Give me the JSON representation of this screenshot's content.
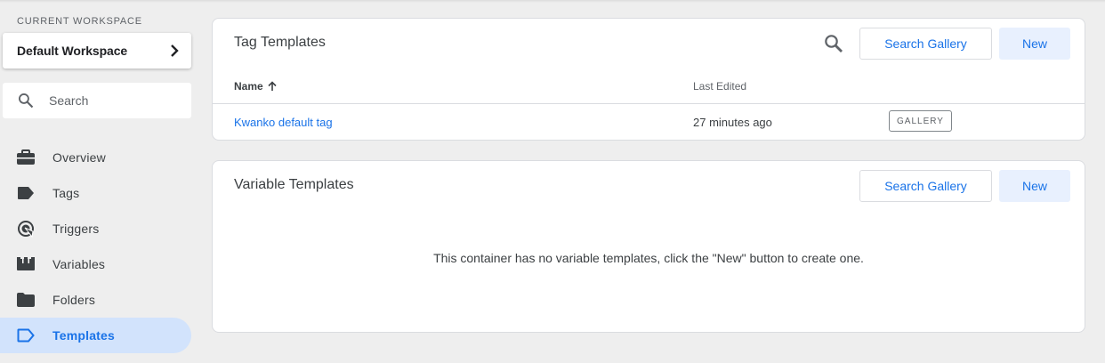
{
  "workspace": {
    "label": "CURRENT WORKSPACE",
    "name": "Default Workspace"
  },
  "search": {
    "placeholder": "Search"
  },
  "nav": {
    "items": [
      {
        "label": "Overview",
        "icon": "briefcase-icon"
      },
      {
        "label": "Tags",
        "icon": "tag-icon"
      },
      {
        "label": "Triggers",
        "icon": "trigger-icon"
      },
      {
        "label": "Variables",
        "icon": "variables-icon"
      },
      {
        "label": "Folders",
        "icon": "folder-icon"
      },
      {
        "label": "Templates",
        "icon": "template-icon",
        "active": true
      }
    ]
  },
  "tag_templates": {
    "title": "Tag Templates",
    "search_gallery_label": "Search Gallery",
    "new_label": "New",
    "columns": {
      "name": "Name",
      "last_edited": "Last Edited"
    },
    "rows": [
      {
        "name": "Kwanko default tag",
        "last_edited": "27 minutes ago",
        "badge": "GALLERY"
      }
    ]
  },
  "variable_templates": {
    "title": "Variable Templates",
    "search_gallery_label": "Search Gallery",
    "new_label": "New",
    "empty_message": "This container has no variable templates, click the \"New\" button to create one."
  },
  "colors": {
    "accent": "#1a73e8",
    "active_nav_bg": "#d2e3fc",
    "new_button_bg": "#e8f0fe",
    "page_bg": "#eeeeee"
  }
}
